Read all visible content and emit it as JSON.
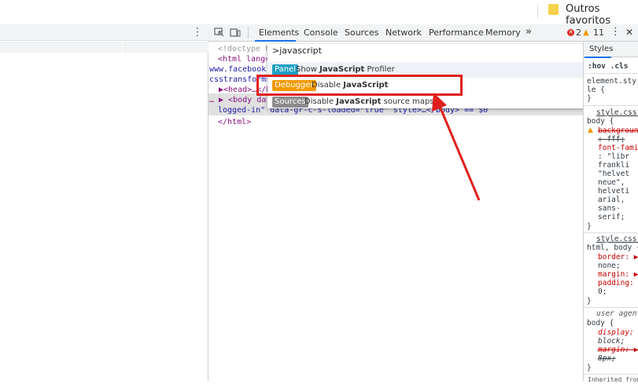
{
  "bookmarks": {
    "folder_label": "Outros favoritos",
    "folder_icon": "folder-icon"
  },
  "page": {
    "menu_icon": "⋮"
  },
  "devtools": {
    "tabs": [
      "Elements",
      "Console",
      "Sources",
      "Network",
      "Performance",
      "Memory"
    ],
    "more_tabs": "»",
    "active_tab": "Elements",
    "errors": "2",
    "warnings": "11",
    "menu": "⋮",
    "close": "✕"
  },
  "dom": {
    "lines": [
      "<!doctype ht",
      "<html lang=\"",
      "www.facebook.c",
      "csstransforms",
      "▶<head>…</he",
      "… ▶ <body data-",
      "logged-in\" data-gr-c-s-loaded=\"true\" style>…</body> == $0",
      "</html>"
    ]
  },
  "palette": {
    "input": ">javascript",
    "items": [
      {
        "badge": "Panel",
        "prefix": "Show ",
        "bold": "JavaScript",
        "suffix": " Profiler",
        "badge_color": "#1ea0c3"
      },
      {
        "badge": "Debugger",
        "prefix": "Disable ",
        "bold": "JavaScript",
        "suffix": "",
        "badge_color": "#f29900"
      },
      {
        "badge": "Sources",
        "prefix": "Disable ",
        "bold": "JavaScript",
        "suffix": " source maps",
        "badge_color": "#8c8c8c"
      }
    ]
  },
  "styles": {
    "tab": "Styles",
    "filter": ":hov  .cls",
    "lines": [
      "element.sty",
      "le {",
      "}",
      "style.css?",
      "body {",
      "background",
      "  : fff;",
      "font-famil",
      "  : \"libr",
      "  frankli",
      "  \"helvet",
      "  neue\",",
      "  helveti",
      "  arial,",
      "  sans-",
      "  serif;",
      "}",
      "style.css?",
      "html, body {",
      "border: ▶",
      "   none;",
      "margin: ▶ 0",
      "padding: ▶",
      "   0;",
      "}",
      "user agent",
      "body {",
      "display:",
      "   block;",
      "margin: ▶",
      "   8px;",
      "}",
      "Inherited from"
    ]
  },
  "colors": {
    "accent": "#1a73e8",
    "highlight_box": "#e0201f",
    "arrow": "#e0201f"
  }
}
